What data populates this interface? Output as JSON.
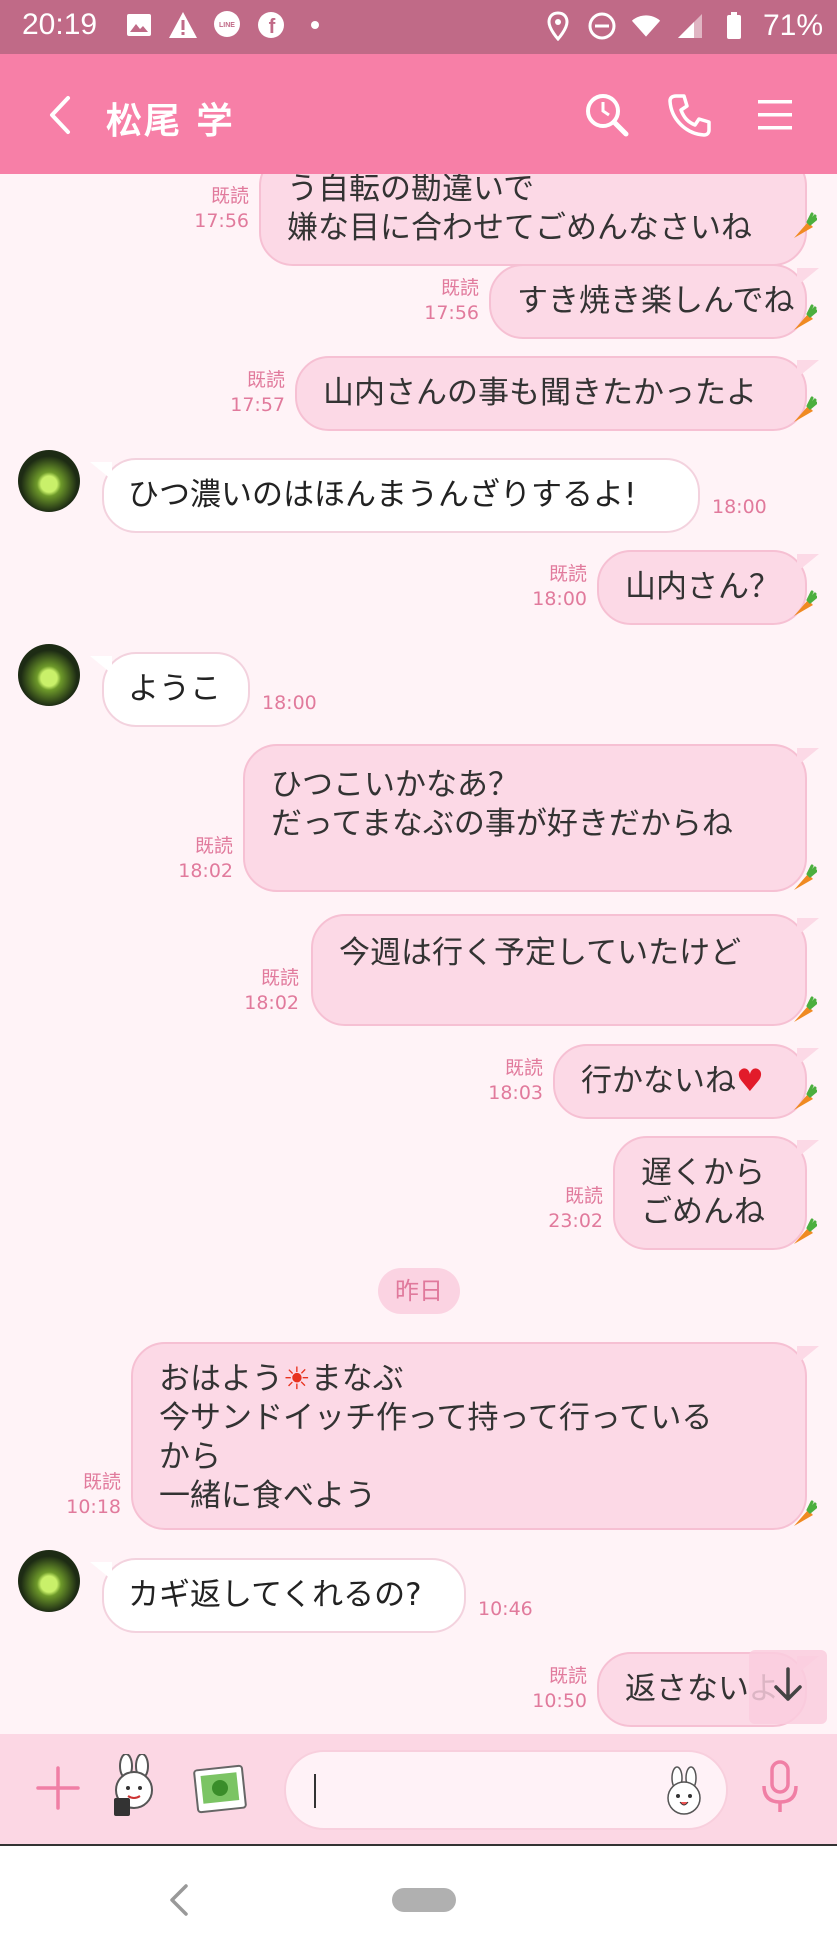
{
  "status_bar": {
    "time": "20:19",
    "battery": "71%",
    "icons": [
      "image-icon",
      "warning-icon",
      "line-icon",
      "facebook-icon",
      "dot-icon",
      "location-icon",
      "dnd-icon",
      "wifi-icon",
      "signal-icon",
      "battery-icon"
    ]
  },
  "header": {
    "title": "松尾 学",
    "icons": [
      "back-icon",
      "search-icon",
      "phone-icon",
      "menu-icon"
    ]
  },
  "messages": [
    {
      "side": "out",
      "text": "う自転の勘違いで\n嫌な目に合わせてごめんなさいね",
      "read": "既読",
      "time": "17:56"
    },
    {
      "side": "out",
      "text": "すき焼き楽しんでね",
      "read": "既読",
      "time": "17:56"
    },
    {
      "side": "out",
      "text": "山内さんの事も聞きたかったよ",
      "read": "既読",
      "time": "17:57"
    },
    {
      "side": "in",
      "text": "ひつ濃いのはほんまうんざりするよ!",
      "time": "18:00"
    },
    {
      "side": "out",
      "text": "山内さん？",
      "read": "既読",
      "time": "18:00"
    },
    {
      "side": "in",
      "text": "ようこ",
      "time": "18:00"
    },
    {
      "side": "out",
      "text": "ひつこいかなあ？\nだってまなぶの事が好きだからね",
      "read": "既読",
      "time": "18:02"
    },
    {
      "side": "out",
      "text": "今週は行く予定していたけど",
      "read": "既読",
      "time": "18:02"
    },
    {
      "side": "out",
      "text": "行かないね♥",
      "read": "既読",
      "time": "18:03"
    },
    {
      "side": "out",
      "text": "遅くから\nごめんね",
      "read": "既読",
      "time": "23:02"
    },
    {
      "side": "date",
      "text": "昨日"
    },
    {
      "side": "out",
      "text": "おはよう☀まなぶ\n今サンドイッチ作って持って行っている\nから\n一緒に食べよう",
      "read": "既読",
      "time": "10:18"
    },
    {
      "side": "in",
      "text": "カギ返してくれるの?",
      "time": "10:46"
    },
    {
      "side": "out",
      "text": "返さないよ",
      "read": "既読",
      "time": "10:50"
    }
  ],
  "input_bar": {
    "placeholder": "",
    "icons": [
      "plus-icon",
      "sticker-icon",
      "photo-icon",
      "emoji-icon",
      "mic-icon"
    ]
  },
  "colors": {
    "header": "#f77fa7",
    "status_bar": "#c06a87",
    "bubble_out": "#fcd9e6",
    "bubble_in": "#ffffff",
    "meta": "#e17a9c",
    "background": "#fff3f7"
  }
}
